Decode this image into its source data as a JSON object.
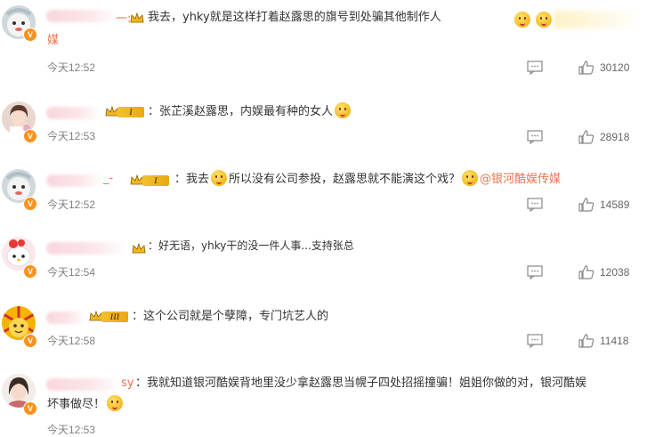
{
  "comments": [
    {
      "badge": "V",
      "name_visible": "一:",
      "crown_tag": "",
      "text_before": "我去，yhky就是这样打着赵露思的旗号到处骗其他制作人",
      "text_line2": "媒",
      "time": "今天12:52",
      "likes": "30120"
    },
    {
      "badge": "V",
      "crown_tag": "I",
      "text": "：张芷溪赵露思，内娱最有种的女人",
      "time": "今天12:53",
      "likes": "28918"
    },
    {
      "badge": "V",
      "name_visible": "_-",
      "crown_tag": "I",
      "text_before": "：我去",
      "text_mid": "所以没有公司参投，赵露思就不能演这个戏？",
      "mention": "@银河酷娱传媒",
      "time": "今天12:52",
      "likes": "14589"
    },
    {
      "badge": "V",
      "crown_tag": "",
      "text": "：好无语，yhky干的没一件人事...支持张总",
      "time": "今天12:54",
      "likes": "12038"
    },
    {
      "badge": "V",
      "crown_tag": "III",
      "text": "：这个公司就是个孽障，专门坑艺人的",
      "time": "今天12:58",
      "likes": "11418"
    },
    {
      "badge": "V",
      "name_visible": "sy",
      "text": "：我就知道银河酷娱背地里没少拿赵露思当幌子四处招摇撞骗！姐姐你做的对，银河酷娱",
      "text_line2": "坏事做尽！",
      "time": "今天12:53"
    }
  ],
  "colors": {
    "accent": "#eb7350",
    "time": "#808080",
    "vbadge": "#f7931e",
    "crown": "#f2c230"
  },
  "icons": {
    "reply": "comment-bubble-icon",
    "like": "thumbs-up-icon",
    "crown": "crown-icon"
  }
}
